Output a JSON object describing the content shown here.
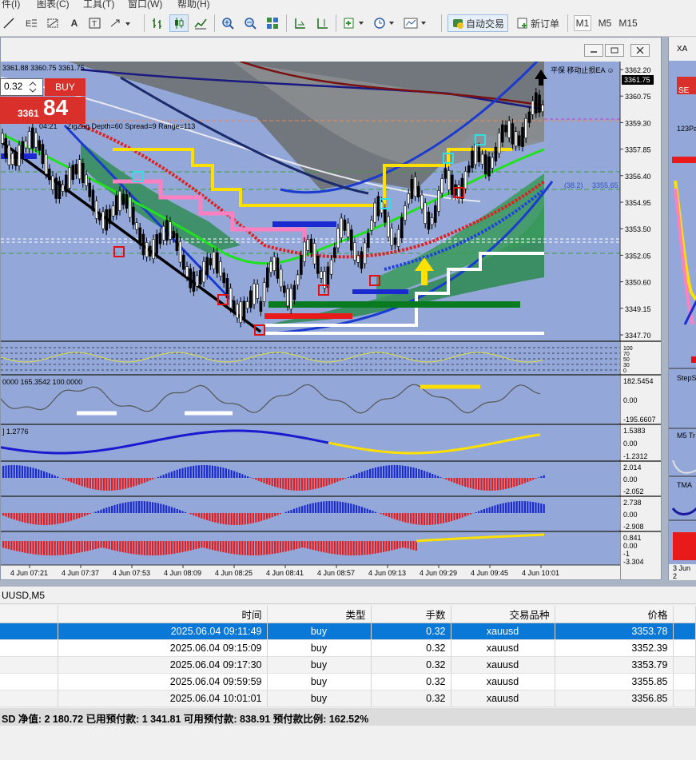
{
  "menu": [
    "图表(C)",
    "工具(T)",
    "窗口(W)",
    "帮助(H)",
    "件(I)"
  ],
  "toolbar": {
    "autotrade_label": "自动交易",
    "neworder_label": "新订单",
    "timeframes": [
      "M1",
      "M5",
      "M15"
    ]
  },
  "chart": {
    "ohlc": "3361.88 3360.75 3361.75",
    "indicator_info": "ZigZag Depth=60  Spread=9  Range=113",
    "time_info": "04:21",
    "ea_label": "平保 移动止损EA ☺",
    "price_current": "3361.75",
    "lot_value": "0.32",
    "buy_label": "BUY",
    "price_big_prefix": "3361",
    "price_big_suffix": "84",
    "line_label": "(38.2)",
    "line_price": "3355.65",
    "price_ticks": [
      "3362.20",
      "3360.75",
      "3359.30",
      "3357.85",
      "3356.40",
      "3354.95",
      "3353.50",
      "3352.05",
      "3350.60",
      "3349.15",
      "3347.70"
    ],
    "time_ticks": [
      "4 Jun 07:21",
      "4 Jun 07:37",
      "4 Jun 07:53",
      "4 Jun 08:09",
      "4 Jun 08:25",
      "4 Jun 08:41",
      "4 Jun 08:57",
      "4 Jun 09:13",
      "4 Jun 09:29",
      "4 Jun 09:45",
      "4 Jun 10:01"
    ],
    "sub1_ticks": [
      "100",
      "70",
      "50",
      "30",
      "0"
    ],
    "sub2_label": "0000 165.3542 100.0000",
    "sub2_ticks": [
      "182.5454",
      "0.00",
      "-195.6607"
    ],
    "sub3_label": "] 1.2776",
    "sub3_ticks": [
      "1.5383",
      "0.00",
      "-1.2312"
    ],
    "sub4_ticks": [
      "2.014",
      "0.00",
      "-2.052"
    ],
    "sub5_ticks": [
      "2.738",
      "0.00",
      "-2.908"
    ],
    "sub6_ticks": [
      "0.841",
      "0.00",
      "-1",
      "-3.304"
    ]
  },
  "chart2": {
    "title": "XA",
    "sell_label": "SE",
    "sub_labels": [
      "123Pa",
      "StepS",
      "M5 Tr",
      "TMA"
    ],
    "time_tick": "3 Jun 2"
  },
  "panel": {
    "title": "UUSD,M5",
    "columns": [
      "时间",
      "类型",
      "手数",
      "交易品种",
      "价格"
    ],
    "rows": [
      {
        "time": "2025.06.04 09:11:49",
        "type": "buy",
        "lots": "0.32",
        "symbol": "xauusd",
        "price": "3353.78"
      },
      {
        "time": "2025.06.04 09:15:09",
        "type": "buy",
        "lots": "0.32",
        "symbol": "xauusd",
        "price": "3352.39"
      },
      {
        "time": "2025.06.04 09:17:30",
        "type": "buy",
        "lots": "0.32",
        "symbol": "xauusd",
        "price": "3353.79"
      },
      {
        "time": "2025.06.04 09:59:59",
        "type": "buy",
        "lots": "0.32",
        "symbol": "xauusd",
        "price": "3355.85"
      },
      {
        "time": "2025.06.04 10:01:01",
        "type": "buy",
        "lots": "0.32",
        "symbol": "xauusd",
        "price": "3356.85"
      }
    ],
    "status": "SD  净值: 2 180.72  已用预付款: 1 341.81  可用预付款: 838.91  预付款比例: 162.52%"
  },
  "colors": {
    "chart_bg": "#93a8d8",
    "buy_red": "#d9302c",
    "selected_row": "#0a78d7"
  }
}
